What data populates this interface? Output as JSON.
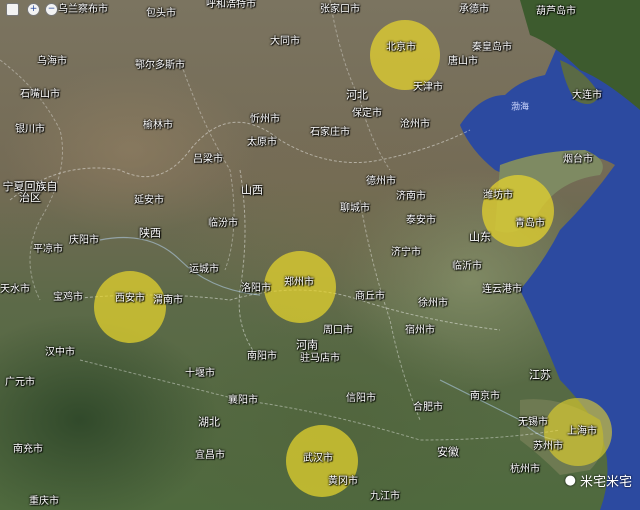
{
  "map_controls": [
    {
      "name": "fullscreen-button",
      "glyph": ""
    },
    {
      "name": "zoom-in-button",
      "glyph": "+"
    },
    {
      "name": "zoom-out-button",
      "glyph": "−"
    }
  ],
  "highlighted_cities": [
    {
      "name": "北京市"
    },
    {
      "name": "潍坊市"
    },
    {
      "name": "青岛市"
    },
    {
      "name": "郑州市"
    },
    {
      "name": "西安市"
    },
    {
      "name": "武汉市"
    },
    {
      "name": "上海市"
    }
  ],
  "province_labels": [
    "河北",
    "山西",
    "陕西",
    "山东",
    "河南",
    "湖北",
    "江苏",
    "安徽",
    "宁夏回族自治区"
  ],
  "sea_labels": [
    "渤海"
  ],
  "city_labels": [
    "包头市",
    "呼和浩特市",
    "张家口市",
    "承德市",
    "葫芦岛市",
    "秦皇岛市",
    "唐山市",
    "天津市",
    "大连市",
    "保定市",
    "沧州市",
    "石家庄市",
    "太原市",
    "忻州市",
    "大同市",
    "鄂尔多斯市",
    "榆林市",
    "吕梁市",
    "延安市",
    "临汾市",
    "运城市",
    "渭南市",
    "宝鸡市",
    "天水市",
    "平凉市",
    "庆阳市",
    "济南市",
    "泰安市",
    "聊城市",
    "德州市",
    "济宁市",
    "临沂市",
    "连云港市",
    "徐州市",
    "宿州市",
    "商丘市",
    "洛阳市",
    "南阳市",
    "周口市",
    "驻马店市",
    "信阳市",
    "合肥市",
    "南京市",
    "无锡市",
    "苏州市",
    "杭州市",
    "十堰市",
    "襄阳市",
    "宜昌市",
    "黄冈市",
    "九江市",
    "汉中市",
    "广元市",
    "南充市",
    "重庆市",
    "乌海市",
    "石嘴山市",
    "银川市",
    "烟台市",
    "乌兰察布市"
  ],
  "watermark": {
    "text": "米宅米宅",
    "icon": "wechat-icon"
  }
}
